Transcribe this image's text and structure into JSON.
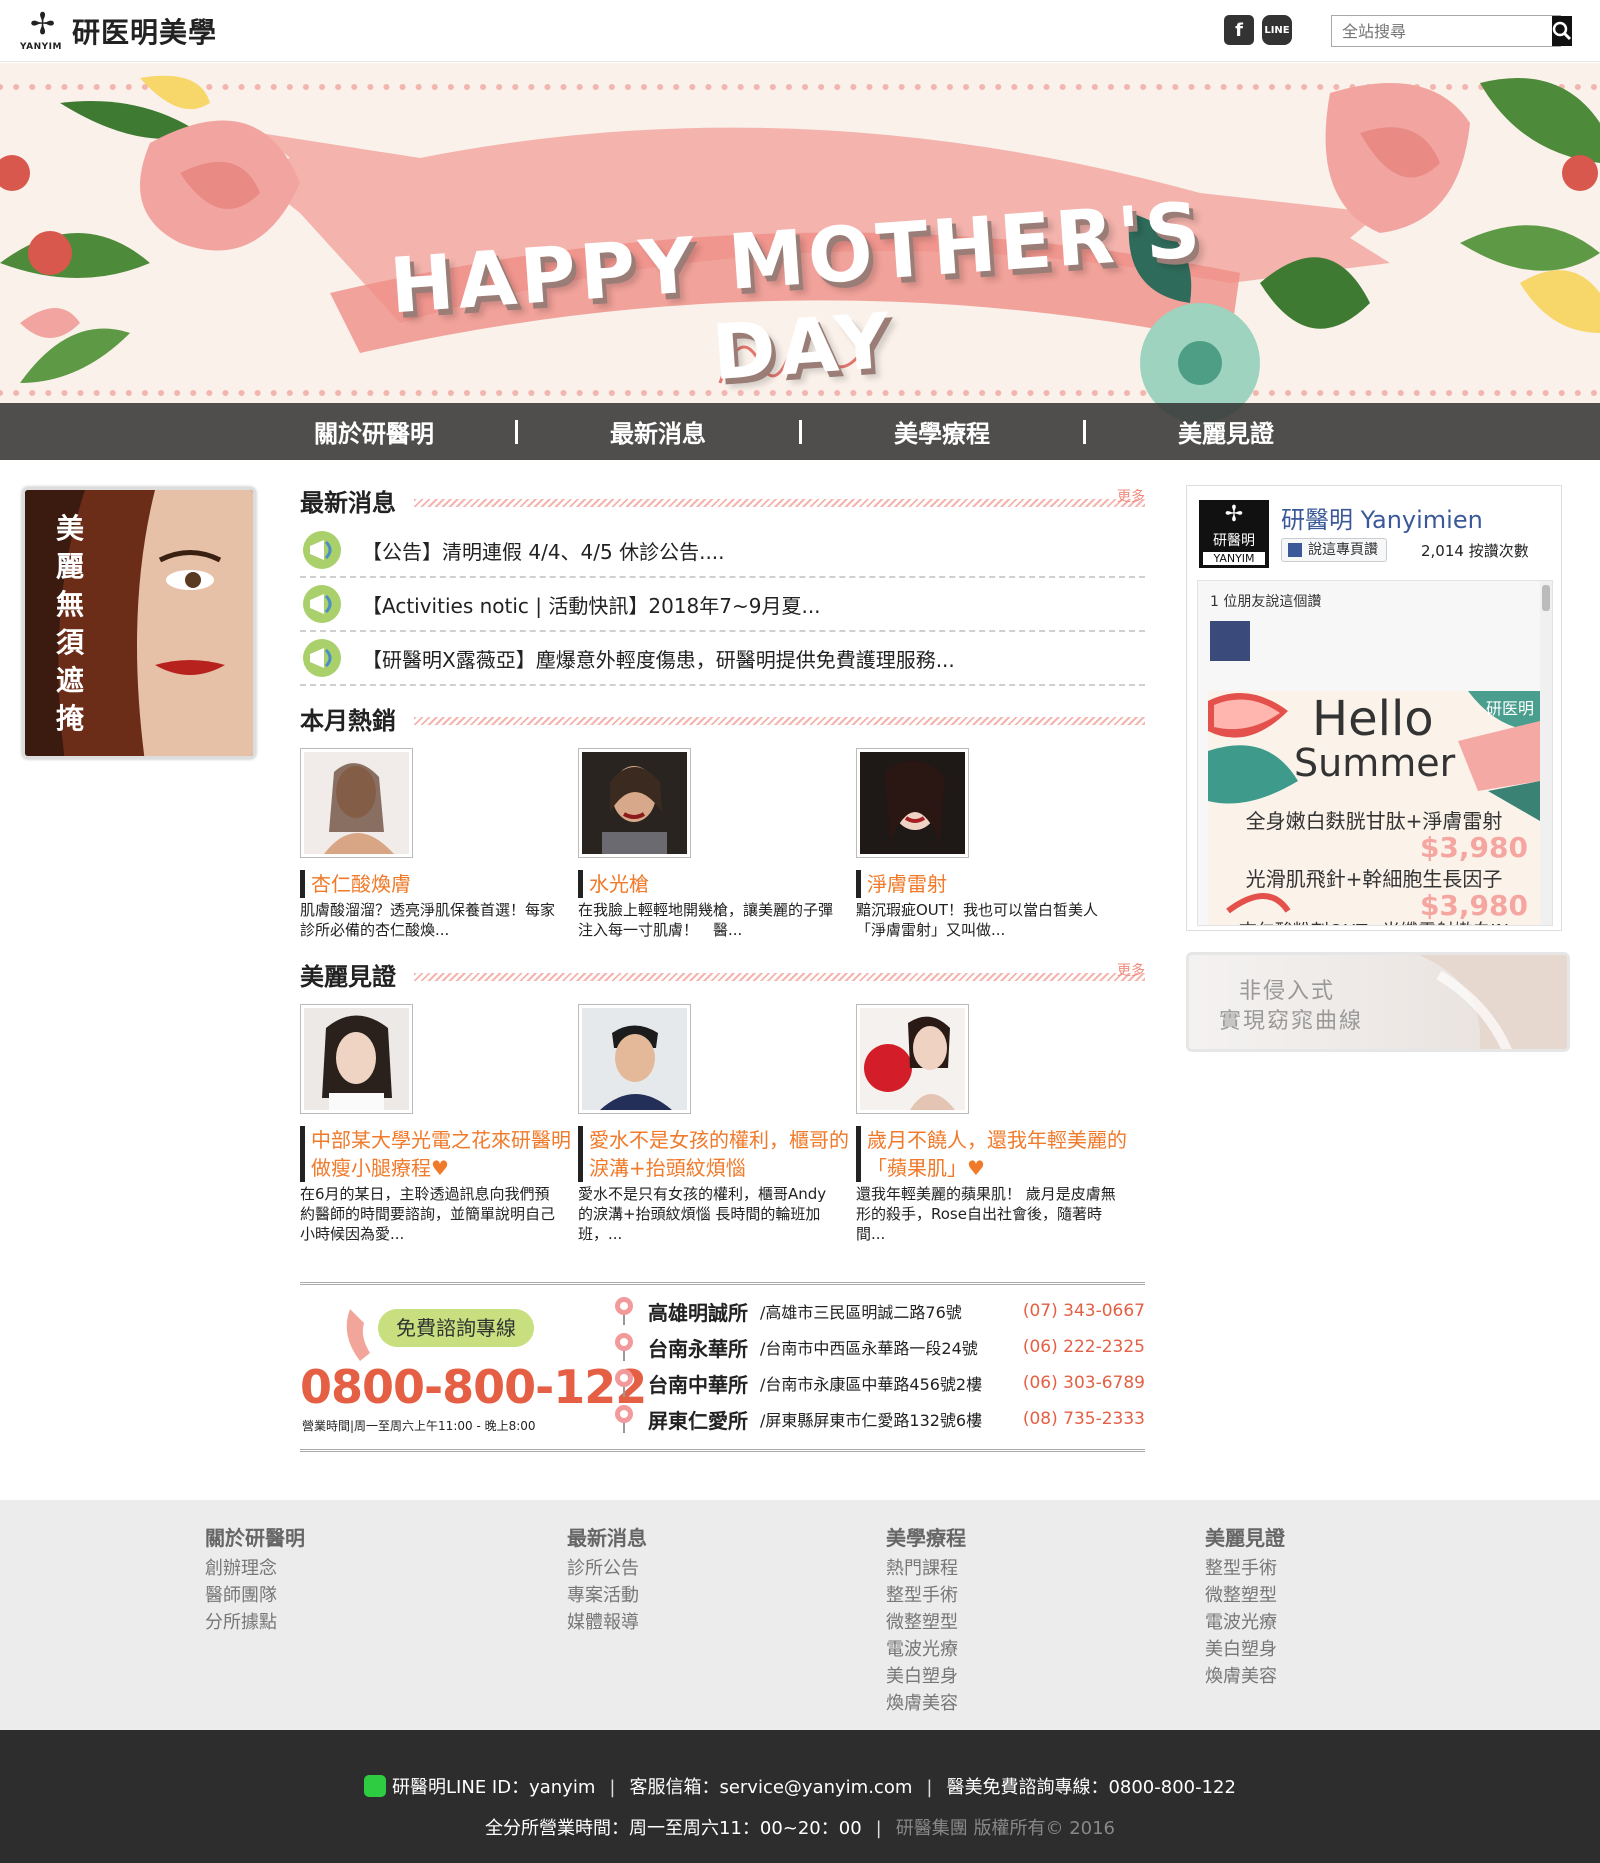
{
  "header": {
    "logo_sub": "YANYIM",
    "logo_text": "研医明美學",
    "search_placeholder": "全站搜尋",
    "social": [
      "facebook-icon",
      "line-icon"
    ],
    "line_label": "LINE"
  },
  "banner": {
    "title": "HAPPY MOTHER'S DAY",
    "nav": [
      "關於研醫明",
      "最新消息",
      "美學療程",
      "美麗見證"
    ]
  },
  "portrait": {
    "text": [
      "美",
      "麗",
      "無",
      "須",
      "遮",
      "掩"
    ]
  },
  "news": {
    "heading": "最新消息",
    "more": "更多",
    "items": [
      "【公告】清明連假 4/4、4/5 休診公告....",
      "【Activities notic | 活動快訊】2018年7~9月夏...",
      "【研醫明X露薇亞】塵爆意外輕度傷患，研醫明提供免費護理服務..."
    ]
  },
  "hot": {
    "heading": "本月熱銷",
    "items": [
      {
        "title": "杏仁酸煥膚",
        "desc": "肌膚酸溜溜？透亮淨肌保養首選！每家診所必備的杏仁酸煥..."
      },
      {
        "title": "水光槍",
        "desc": "在我臉上輕輕地開幾槍，讓美麗的子彈注入每一寸肌膚！　醫..."
      },
      {
        "title": "淨膚雷射",
        "desc": "黯沉瑕疵OUT！我也可以當白皙美人　「淨膚雷射」又叫做..."
      }
    ]
  },
  "testimonials": {
    "heading": "美麗見證",
    "more": "更多",
    "items": [
      {
        "title": "中部某大學光電之花來研醫明做瘦小腿療程♥",
        "desc": "在6月的某日，主聆透過訊息向我們預約醫師的時間要諮詢，並簡單說明自己小時候因為愛..."
      },
      {
        "title": "愛水不是女孩的權利，櫃哥的淚溝+抬頭紋煩惱",
        "desc": "愛水不是只有女孩的權利，櫃哥Andy的淚溝+抬頭紋煩惱 長時間的輪班加班，..."
      },
      {
        "title": "歲月不饒人，還我年輕美麗的「蘋果肌」♥",
        "desc": "還我年輕美麗的蘋果肌！ 歲月是皮膚無形的殺手，Rose自出社會後，隨著時間..."
      }
    ]
  },
  "contact": {
    "bubble": "免費諮詢專線",
    "phone": "0800-800-122",
    "hours": "營業時間|周一至周六上午11:00 - 晚上8:00",
    "branches": [
      {
        "name": "高雄明誠所",
        "addr": "/高雄市三民區明誠二路76號",
        "tel": "(07) 343-0667"
      },
      {
        "name": "台南永華所",
        "addr": "/台南市中西區永華路一段24號",
        "tel": "(06) 222-2325"
      },
      {
        "name": "台南中華所",
        "addr": "/台南市永康區中華路456號2樓",
        "tel": "(06) 303-6789"
      },
      {
        "name": "屏東仁愛所",
        "addr": "/屏東縣屏東市仁愛路132號6樓",
        "tel": "(08) 735-2333"
      }
    ]
  },
  "facebook": {
    "logo_main": "研醫明",
    "logo_sub": "YANYIM",
    "page_name": "研醫明 Yanyimien",
    "like_button": "說這專頁讚",
    "like_count": "2,014 按讚次數",
    "friends": "1 位朋友說這個讚",
    "promo": {
      "brand": "研医明",
      "hello": "Hello",
      "summer": "Summer",
      "line1": "全身嫩白麩胱甘肽+淨膚雷射",
      "price1": "$3,980",
      "line2": "光滑肌飛針+幹細胞生長因子",
      "price2": "$3,980",
      "line3": "杏仁酸粉刺OUT+光纖雷射嫩白IN"
    }
  },
  "side_ad": {
    "line1": "非侵入式",
    "line2": "實現窈窕曲線"
  },
  "sitemap": [
    {
      "title": "關於研醫明",
      "links": [
        "創辦理念",
        "醫師團隊",
        "分所據點"
      ]
    },
    {
      "title": "最新消息",
      "links": [
        "診所公告",
        "專案活動",
        "媒體報導"
      ]
    },
    {
      "title": "美學療程",
      "links": [
        "熱門課程",
        "整型手術",
        "微整塑型",
        "電波光療",
        "美白塑身",
        "煥膚美容"
      ]
    },
    {
      "title": "美麗見證",
      "links": [
        "整型手術",
        "微整塑型",
        "電波光療",
        "美白塑身",
        "煥膚美容"
      ]
    }
  ],
  "footer": {
    "line_id": "研醫明LINE ID：yanyim",
    "email": "客服信箱：service@yanyim.com",
    "hotline": "醫美免費諮詢專線：0800-800-122",
    "hours": "全分所營業時間：周一至周六11：00~20：00",
    "copyright": "研醫集團 版權所有© 2016"
  },
  "colors": {
    "accent_orange": "#f07a2a",
    "phone_red": "#e45f43",
    "nav_bg": "#373737",
    "footer_bg": "#2d2d2d"
  }
}
